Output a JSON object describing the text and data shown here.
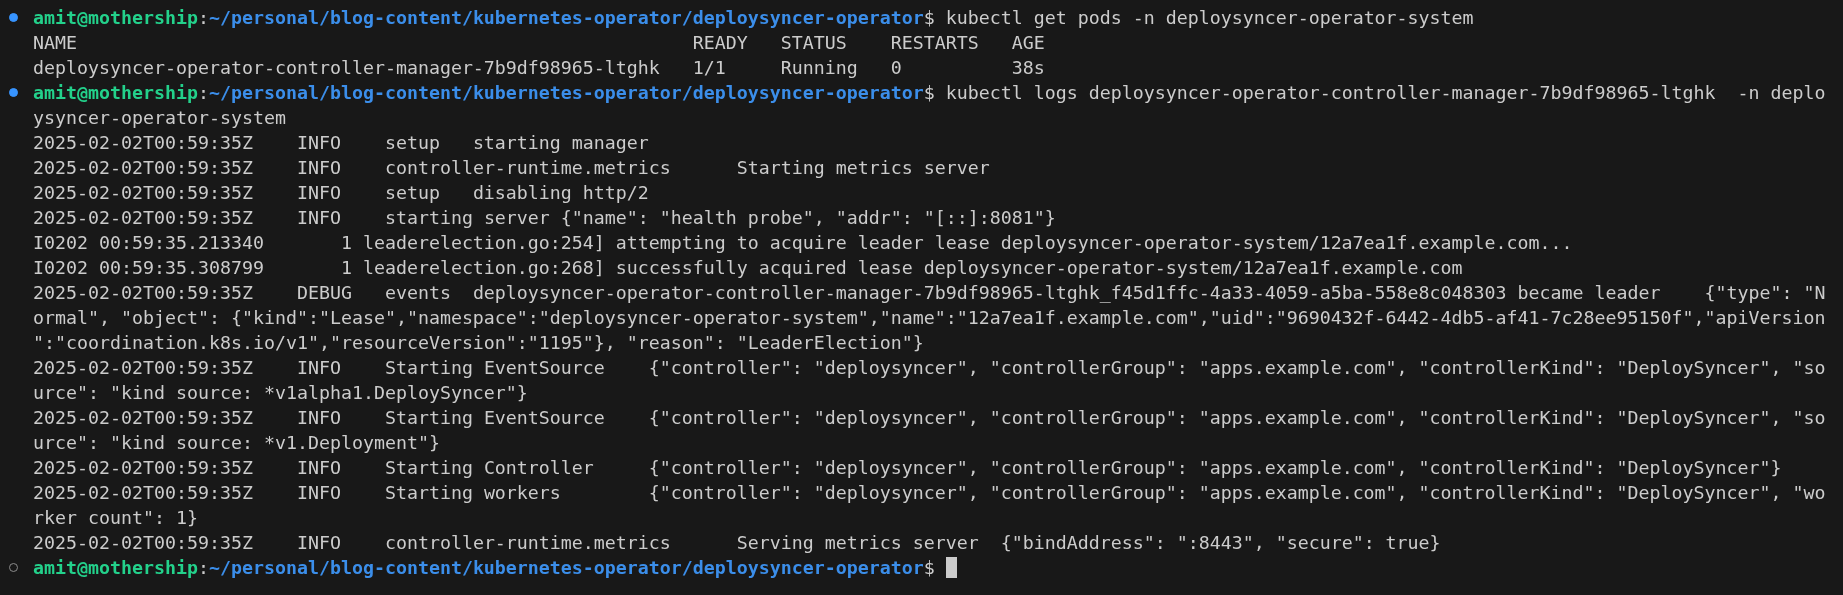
{
  "terminal": {
    "lines": [
      {
        "kind": "prompt",
        "succeeded": true,
        "user": "amit@mothership",
        "separator": ":",
        "path": "~/personal/blog-content/kubernetes-operator/deploysyncer-operator",
        "symbol": "$",
        "command": "kubectl get pods -n deploysyncer-operator-system",
        "cursor": false
      },
      {
        "kind": "output",
        "text": "NAME                                                        READY   STATUS    RESTARTS   AGE"
      },
      {
        "kind": "output",
        "text": "deploysyncer-operator-controller-manager-7b9df98965-ltghk   1/1     Running   0          38s"
      },
      {
        "kind": "prompt",
        "succeeded": true,
        "user": "amit@mothership",
        "separator": ":",
        "path": "~/personal/blog-content/kubernetes-operator/deploysyncer-operator",
        "symbol": "$",
        "command": "kubectl logs deploysyncer-operator-controller-manager-7b9df98965-ltghk  -n deplo",
        "cursor": false
      },
      {
        "kind": "output",
        "text": "ysyncer-operator-system"
      },
      {
        "kind": "output",
        "text": "2025-02-02T00:59:35Z\tINFO\tsetup\tstarting manager"
      },
      {
        "kind": "output",
        "text": "2025-02-02T00:59:35Z\tINFO\tcontroller-runtime.metrics\tStarting metrics server"
      },
      {
        "kind": "output",
        "text": "2025-02-02T00:59:35Z\tINFO\tsetup\tdisabling http/2"
      },
      {
        "kind": "output",
        "text": "2025-02-02T00:59:35Z\tINFO\tstarting server {\"name\": \"health probe\", \"addr\": \"[::]:8081\"}"
      },
      {
        "kind": "output",
        "text": "I0202 00:59:35.213340       1 leaderelection.go:254] attempting to acquire leader lease deploysyncer-operator-system/12a7ea1f.example.com..."
      },
      {
        "kind": "output",
        "text": "I0202 00:59:35.308799       1 leaderelection.go:268] successfully acquired lease deploysyncer-operator-system/12a7ea1f.example.com"
      },
      {
        "kind": "output",
        "text": "2025-02-02T00:59:35Z\tDEBUG\tevents\tdeploysyncer-operator-controller-manager-7b9df98965-ltghk_f45d1ffc-4a33-4059-a5ba-558e8c048303 became leader\t{\"type\": \"N"
      },
      {
        "kind": "output",
        "text": "ormal\", \"object\": {\"kind\":\"Lease\",\"namespace\":\"deploysyncer-operator-system\",\"name\":\"12a7ea1f.example.com\",\"uid\":\"9690432f-6442-4db5-af41-7c28ee95150f\",\"apiVersion"
      },
      {
        "kind": "output",
        "text": "\":\"coordination.k8s.io/v1\",\"resourceVersion\":\"1195\"}, \"reason\": \"LeaderElection\"}"
      },
      {
        "kind": "output",
        "text": "2025-02-02T00:59:35Z\tINFO\tStarting EventSource\t{\"controller\": \"deploysyncer\", \"controllerGroup\": \"apps.example.com\", \"controllerKind\": \"DeploySyncer\", \"so"
      },
      {
        "kind": "output",
        "text": "urce\": \"kind source: *v1alpha1.DeploySyncer\"}"
      },
      {
        "kind": "output",
        "text": "2025-02-02T00:59:35Z\tINFO\tStarting EventSource\t{\"controller\": \"deploysyncer\", \"controllerGroup\": \"apps.example.com\", \"controllerKind\": \"DeploySyncer\", \"so"
      },
      {
        "kind": "output",
        "text": "urce\": \"kind source: *v1.Deployment\"}"
      },
      {
        "kind": "output",
        "text": "2025-02-02T00:59:35Z\tINFO\tStarting Controller\t{\"controller\": \"deploysyncer\", \"controllerGroup\": \"apps.example.com\", \"controllerKind\": \"DeploySyncer\"}"
      },
      {
        "kind": "output",
        "text": "2025-02-02T00:59:35Z\tINFO\tStarting workers\t{\"controller\": \"deploysyncer\", \"controllerGroup\": \"apps.example.com\", \"controllerKind\": \"DeploySyncer\", \"wo"
      },
      {
        "kind": "output",
        "text": "rker count\": 1}"
      },
      {
        "kind": "output",
        "text": "2025-02-02T00:59:35Z\tINFO\tcontroller-runtime.metrics\tServing metrics server\t{\"bindAddress\": \":8443\", \"secure\": true}"
      },
      {
        "kind": "prompt",
        "succeeded": false,
        "user": "amit@mothership",
        "separator": ":",
        "path": "~/personal/blog-content/kubernetes-operator/deploysyncer-operator",
        "symbol": "$",
        "cursor": true
      }
    ]
  }
}
